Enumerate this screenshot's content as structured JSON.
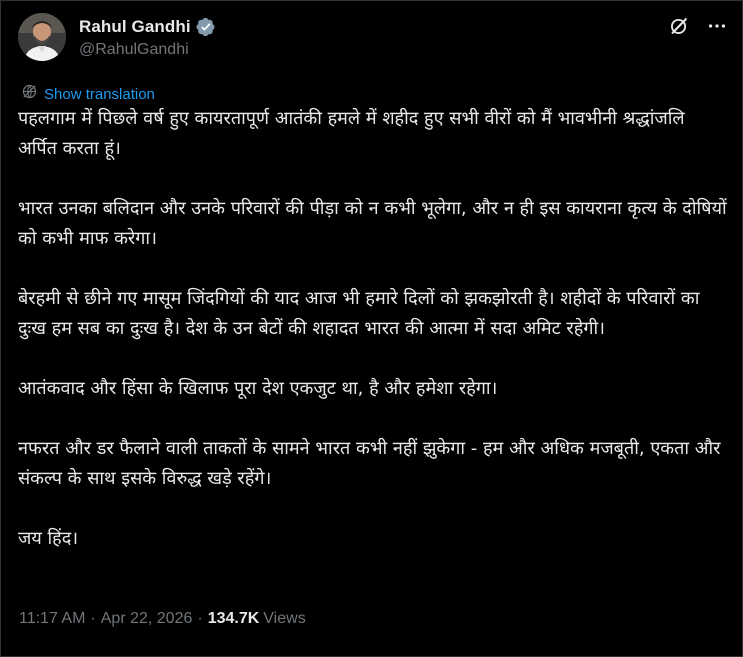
{
  "author": {
    "display_name": "Rahul Gandhi",
    "handle": "@RahulGandhi",
    "verified": true
  },
  "actions": {
    "grok_icon": "grok-icon",
    "more_icon": "more-icon"
  },
  "translate": {
    "label": "Show translation"
  },
  "post": {
    "paragraphs": [
      "पहलगाम में पिछले वर्ष हुए कायरतापूर्ण आतंकी हमले में शहीद हुए सभी वीरों को मैं भावभीनी श्रद्धांजलि अर्पित करता हूं।",
      "भारत उनका बलिदान और उनके परिवारों की पीड़ा को न कभी भूलेगा, और न ही इस कायराना कृत्य के दोषियों को कभी माफ करेगा।",
      "बेरहमी से छीने गए मासूम जिंदगियों की याद आज भी हमारे दिलों को झकझोरती है। शहीदों के परिवारों का दुःख हम सब का दुःख है। देश के उन बेटों की शहादत भारत की आत्मा में सदा अमिट रहेगी।",
      "आतंकवाद और हिंसा के खिलाफ पूरा देश एकजुट था, है और हमेशा रहेगा।",
      "नफरत और डर फैलाने वाली ताकतों के सामने भारत कभी नहीं झुकेगा - हम और अधिक मजबूती, एकता और संकल्प के साथ इसके विरुद्ध खड़े रहेंगे।",
      "जय हिंद।"
    ]
  },
  "meta": {
    "time": "11:17 AM",
    "separator": "·",
    "date": "Apr 22, 2026",
    "views_count": "134.7K",
    "views_label": "Views"
  },
  "colors": {
    "background": "#000000",
    "text": "#e7e9ea",
    "muted": "#71767b",
    "accent": "#1d9bf0"
  }
}
